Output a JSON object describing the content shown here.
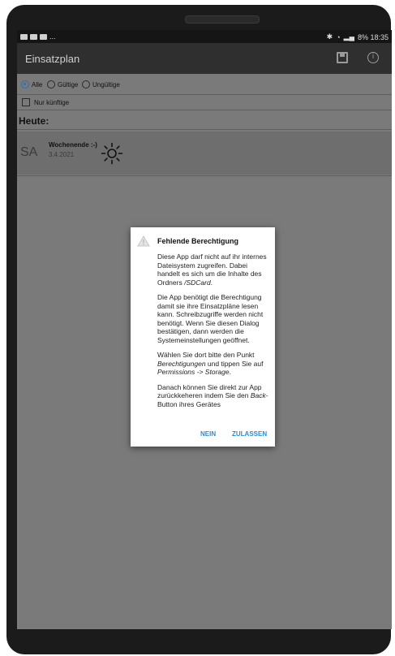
{
  "status_bar": {
    "left_icons": [
      "mail-icon",
      "gallery-icon",
      "youtube-icon"
    ],
    "more": "...",
    "right_text": "8% 18:35"
  },
  "app_bar": {
    "title": "Einsatzplan",
    "actions": [
      "save-icon",
      "info-icon"
    ]
  },
  "filter": {
    "options": [
      "Alle",
      "Gültige",
      "Ungültige"
    ],
    "selected": "Alle",
    "future_only_label": "Nur künftige",
    "future_only_checked": false
  },
  "section_today": "Heute:",
  "entry": {
    "day": "SA",
    "title": "Wochenende :-)",
    "date": "3.4.2021",
    "icon": "sun-icon"
  },
  "dialog": {
    "title": "Fehlende Berechtigung",
    "icon": "warning-icon",
    "p1": "Diese App darf nicht auf ihr internes Dateisystem zugreifen. Dabei handelt es sich um die Inhalte des Ordners ",
    "p1_em": "/SDCard",
    "p1_end": ".",
    "p2": "Die App benötigt die Berechtigung damit sie ihre Einsatzpläne lesen kann. Schreibzugriffe werden nicht benötigt. Wenn Sie diesen Dialog bestätigen, dann werden die Systemeinstellungen geöffnet.",
    "p3_a": "Wählen Sie dort bitte den Punkt ",
    "p3_em1": "Berechtigungen",
    "p3_b": " und tippen Sie auf ",
    "p3_em2": "Permissions -> Storage",
    "p3_c": ".",
    "p4_a": "Danach können Sie direkt zur App zurückkeheren indem Sie den ",
    "p4_em": "Back",
    "p4_b": "- Button ihres Gerätes",
    "deny": "NEIN",
    "allow": "ZULASSEN"
  }
}
